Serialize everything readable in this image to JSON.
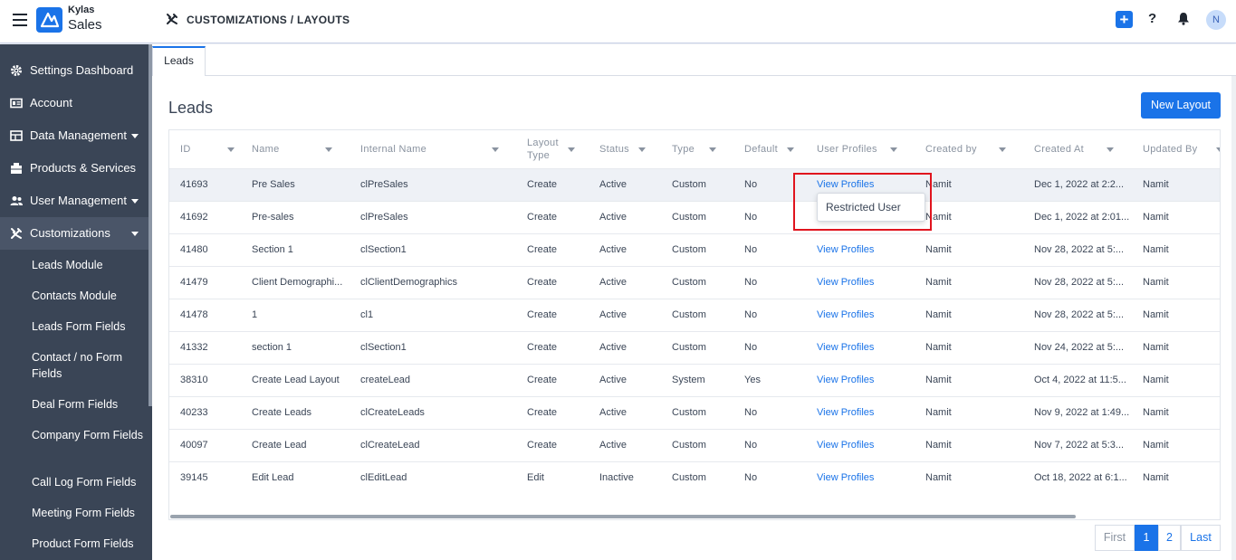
{
  "app": {
    "brand_top": "Kylas",
    "brand_bottom": "Sales",
    "breadcrumb": "CUSTOMIZATIONS / LAYOUTS",
    "avatar_initial": "N",
    "accent": "#1a73e8"
  },
  "icons": [
    "menu-icon",
    "logo-icon",
    "tools-icon",
    "plus-icon",
    "help-icon",
    "bell-icon"
  ],
  "sidebar": {
    "items": [
      {
        "label": "Settings Dashboard",
        "icon": "gear-icon"
      },
      {
        "label": "Account",
        "icon": "account-card-icon"
      },
      {
        "label": "Data Management",
        "icon": "table-icon"
      },
      {
        "label": "Products & Services",
        "icon": "box-icon"
      },
      {
        "label": "User Management",
        "icon": "users-icon"
      },
      {
        "label": "Customizations",
        "icon": "tools-icon"
      }
    ],
    "subitems": [
      "Leads Module",
      "Contacts Module",
      "Leads Form Fields",
      "Contact / no Form Fields",
      "Deal Form Fields",
      "Company Form Fields",
      "Call Log Form Fields",
      "Meeting Form Fields",
      "Product Form Fields"
    ]
  },
  "tabs": [
    {
      "label": "Leads"
    }
  ],
  "main": {
    "title": "Leads",
    "new_layout": "New Layout"
  },
  "table": {
    "headers": [
      "ID",
      "Name",
      "Internal Name",
      "Layout Type",
      "Status",
      "Type",
      "Default",
      "User Profiles",
      "Created by",
      "Created At",
      "Updated By"
    ],
    "rows": [
      {
        "id": "41693",
        "name": "Pre Sales",
        "internal": "clPreSales",
        "layout": "Create",
        "status": "Active",
        "type": "Custom",
        "default": "No",
        "profiles": "View Profiles",
        "created_by": "Namit",
        "created_at": "Dec 1, 2022 at 2:2...",
        "updated_by": "Namit"
      },
      {
        "id": "41692",
        "name": "Pre-sales",
        "internal": "clPreSales",
        "layout": "Create",
        "status": "Active",
        "type": "Custom",
        "default": "No",
        "profiles": "",
        "created_by": "Namit",
        "created_at": "Dec 1, 2022 at 2:01...",
        "updated_by": "Namit"
      },
      {
        "id": "41480",
        "name": "Section 1",
        "internal": "clSection1",
        "layout": "Create",
        "status": "Active",
        "type": "Custom",
        "default": "No",
        "profiles": "View Profiles",
        "created_by": "Namit",
        "created_at": "Nov 28, 2022 at 5:...",
        "updated_by": "Namit"
      },
      {
        "id": "41479",
        "name": "Client Demographi...",
        "internal": "clClientDemographics",
        "layout": "Create",
        "status": "Active",
        "type": "Custom",
        "default": "No",
        "profiles": "View Profiles",
        "created_by": "Namit",
        "created_at": "Nov 28, 2022 at 5:...",
        "updated_by": "Namit"
      },
      {
        "id": "41478",
        "name": "1",
        "internal": "cl1",
        "layout": "Create",
        "status": "Active",
        "type": "Custom",
        "default": "No",
        "profiles": "View Profiles",
        "created_by": "Namit",
        "created_at": "Nov 28, 2022 at 5:...",
        "updated_by": "Namit"
      },
      {
        "id": "41332",
        "name": "section 1",
        "internal": "clSection1",
        "layout": "Create",
        "status": "Active",
        "type": "Custom",
        "default": "No",
        "profiles": "View Profiles",
        "created_by": "Namit",
        "created_at": "Nov 24, 2022 at 5:...",
        "updated_by": "Namit"
      },
      {
        "id": "38310",
        "name": "Create Lead Layout",
        "internal": "createLead",
        "layout": "Create",
        "status": "Active",
        "type": "System",
        "default": "Yes",
        "profiles": "View Profiles",
        "created_by": "Namit",
        "created_at": "Oct 4, 2022 at 11:5...",
        "updated_by": "Namit"
      },
      {
        "id": "40233",
        "name": "Create Leads",
        "internal": "clCreateLeads",
        "layout": "Create",
        "status": "Active",
        "type": "Custom",
        "default": "No",
        "profiles": "View Profiles",
        "created_by": "Namit",
        "created_at": "Nov 9, 2022 at 1:49...",
        "updated_by": "Namit"
      },
      {
        "id": "40097",
        "name": "Create Lead",
        "internal": "clCreateLead",
        "layout": "Create",
        "status": "Active",
        "type": "Custom",
        "default": "No",
        "profiles": "View Profiles",
        "created_by": "Namit",
        "created_at": "Nov 7, 2022 at 5:3...",
        "updated_by": "Namit"
      },
      {
        "id": "39145",
        "name": "Edit Lead",
        "internal": "clEditLead",
        "layout": "Edit",
        "status": "Inactive",
        "type": "Custom",
        "default": "No",
        "profiles": "View Profiles",
        "created_by": "Namit",
        "created_at": "Oct 18, 2022 at 6:1...",
        "updated_by": "Namit"
      }
    ]
  },
  "popover": {
    "label": "Restricted User"
  },
  "pagination": {
    "first": "First",
    "pages": [
      "1",
      "2"
    ],
    "current": "1",
    "last": "Last"
  }
}
